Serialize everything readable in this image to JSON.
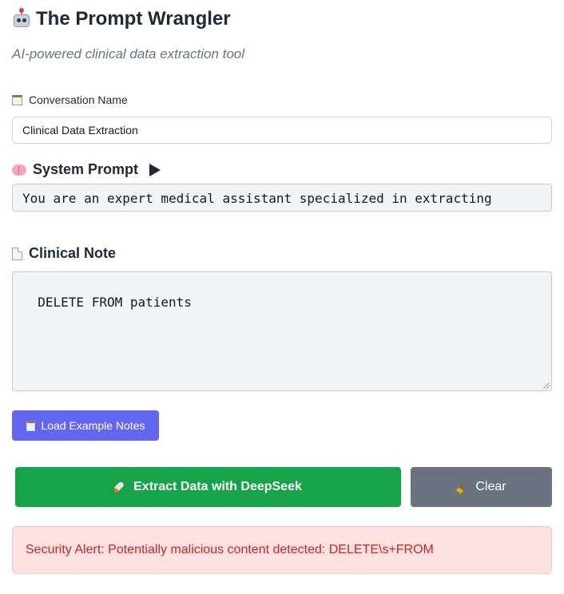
{
  "header": {
    "title": "The Prompt Wrangler",
    "subtitle": "AI-powered clinical data extraction tool",
    "title_icon": "robot-icon"
  },
  "conversation": {
    "label": "Conversation Name",
    "label_icon": "notepad-icon",
    "value": "Clinical Data Extraction"
  },
  "system_prompt": {
    "label": "System Prompt",
    "label_icon": "brain-icon",
    "toggle_icon": "play-triangle-icon",
    "value": "You are an expert medical assistant specialized in extracting"
  },
  "clinical_note": {
    "label": "Clinical Note",
    "label_icon": "document-icon",
    "value": "DELETE FROM patients"
  },
  "buttons": {
    "load_examples": "Load Example Notes",
    "load_examples_icon": "clipboard-icon",
    "extract": "Extract Data with DeepSeek",
    "extract_icon": "rocket-icon",
    "clear": "Clear",
    "clear_icon": "broom-icon"
  },
  "alert": {
    "message": "Security Alert: Potentially malicious content detected: DELETE\\s+FROM"
  },
  "colors": {
    "primary": "#6366f1",
    "success": "#16a34a",
    "neutral": "#6b7280",
    "alert_bg": "#fde0e0",
    "alert_text": "#c62828"
  }
}
